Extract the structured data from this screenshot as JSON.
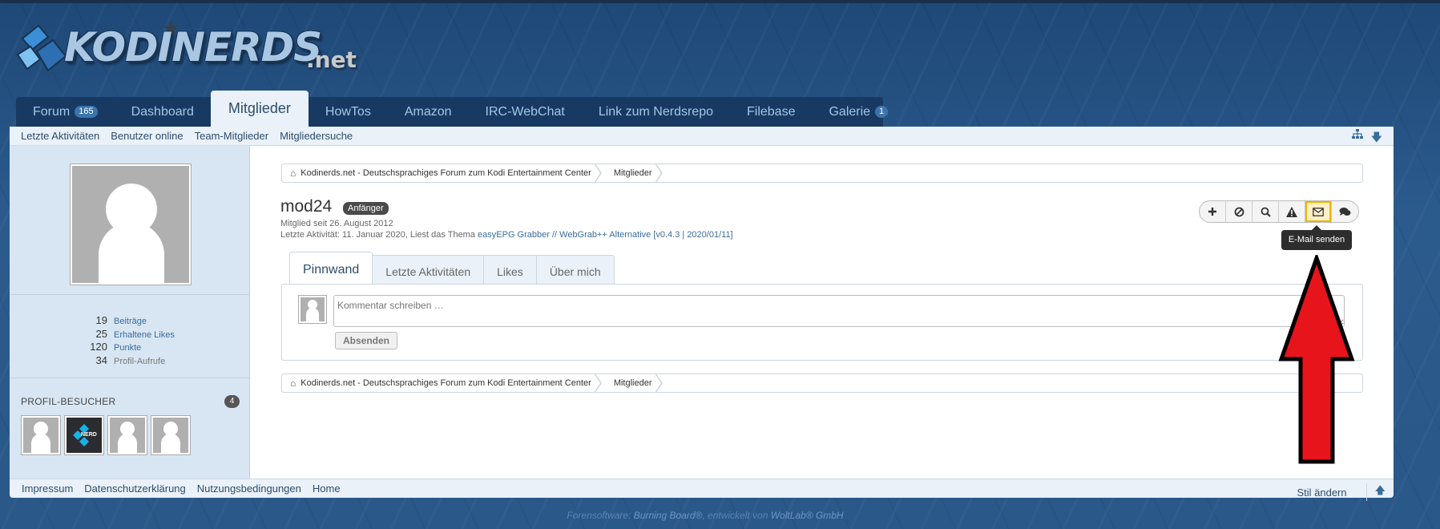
{
  "logo": {
    "text": "KODINERDS",
    "tld": ".net"
  },
  "nav": {
    "items": [
      {
        "label": "Forum",
        "badge": "165"
      },
      {
        "label": "Dashboard"
      },
      {
        "label": "Mitglieder",
        "active": true
      },
      {
        "label": "HowTos"
      },
      {
        "label": "Amazon"
      },
      {
        "label": "IRC-WebChat"
      },
      {
        "label": "Link zum Nerdsrepo"
      },
      {
        "label": "Filebase"
      },
      {
        "label": "Galerie",
        "badge": "1"
      }
    ]
  },
  "subnav": {
    "items": [
      "Letzte Aktivitäten",
      "Benutzer online",
      "Team-Mitglieder",
      "Mitgliedersuche"
    ],
    "icons": [
      "sitemap-icon",
      "arrow-down-icon"
    ]
  },
  "breadcrumb": {
    "items": [
      "Kodinerds.net - Deutschsprachiges Forum zum Kodi Entertainment Center",
      "Mitglieder"
    ]
  },
  "profile": {
    "username": "mod24",
    "rank": "Anfänger",
    "member_since": "Mitglied seit 26. August 2012",
    "last_activity_prefix": "Letzte Aktivität: 11. Januar 2020, Liest das Thema ",
    "last_activity_link": "easyEPG Grabber // WebGrab++ Alternative [v0.4.3 | 2020/01/11]"
  },
  "stats": [
    {
      "value": "19",
      "label": "Beiträge"
    },
    {
      "value": "25",
      "label": "Erhaltene Likes"
    },
    {
      "value": "120",
      "label": "Punkte"
    },
    {
      "value": "34",
      "label": "Profil-Aufrufe"
    }
  ],
  "visitors": {
    "title": "PROFIL-BESUCHER",
    "count": "4",
    "kodi_label": "NERD"
  },
  "actions": {
    "icons": [
      "plus-icon",
      "block-icon",
      "search-icon",
      "warning-icon",
      "envelope-icon",
      "comments-icon"
    ],
    "tooltip": "E-Mail senden"
  },
  "tabs": [
    "Pinnwand",
    "Letzte Aktivitäten",
    "Likes",
    "Über mich"
  ],
  "wall": {
    "placeholder": "Kommentar schreiben …",
    "submit": "Absenden"
  },
  "footer": {
    "items": [
      "Impressum",
      "Datenschutzerklärung",
      "Nutzungsbedingungen",
      "Home"
    ],
    "right": "Stil ändern"
  },
  "copyright": {
    "prefix": "Forensoftware: ",
    "product": "Burning Board®",
    "middle": ", entwickelt von ",
    "company": "WoltLab® GmbH"
  },
  "colors": {
    "accent": "#2d4d6d",
    "annotation_arrow": "#e8141c",
    "highlight": "#f0b400"
  }
}
